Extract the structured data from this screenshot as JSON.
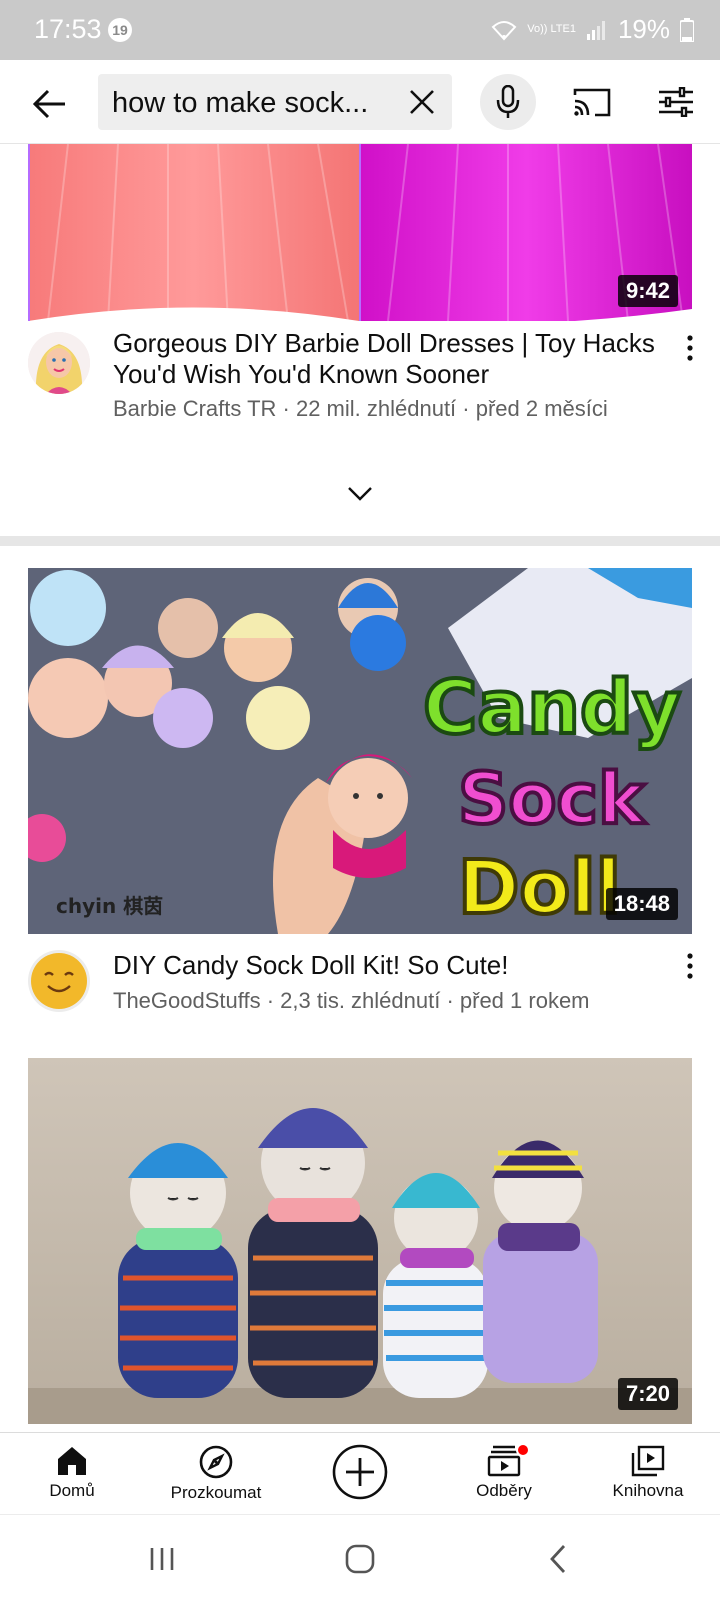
{
  "status_bar": {
    "time": "17:53",
    "notification_count": "19",
    "network_label": "Vo)) LTE1",
    "battery": "19%"
  },
  "header": {
    "search_query": "how to make sock...",
    "icons": [
      "back-arrow-icon",
      "clear-icon",
      "microphone-icon",
      "cast-icon",
      "filter-icon"
    ]
  },
  "videos": [
    {
      "title": "Gorgeous DIY Barbie Doll Dresses | Toy Hacks You'd Wish You'd Known Sooner",
      "channel_line": "Barbie Crafts TR · 22 mil. zhlédnutí · před 2 měsíci",
      "duration": "9:42"
    },
    {
      "title": "DIY Candy Sock Doll Kit! So Cute!",
      "channel_line": "TheGoodStuffs · 2,3 tis. zhlédnutí · před 1 rokem",
      "duration": "18:48",
      "thumb_text": [
        "Candy",
        "Sock",
        "Doll"
      ],
      "thumb_logo": "chyin 棋茵"
    },
    {
      "duration": "7:20"
    }
  ],
  "bottom_nav": [
    {
      "label": "Domů",
      "icon": "home-icon"
    },
    {
      "label": "Prozkoumat",
      "icon": "explore-icon"
    },
    {
      "label": "",
      "icon": "create-icon"
    },
    {
      "label": "Odběry",
      "icon": "subscriptions-icon"
    },
    {
      "label": "Knihovna",
      "icon": "library-icon"
    }
  ],
  "colors": {
    "accent_red": "#ff0000",
    "status_bar_bg": "#c9c9c9",
    "secondary_text": "#606060"
  }
}
